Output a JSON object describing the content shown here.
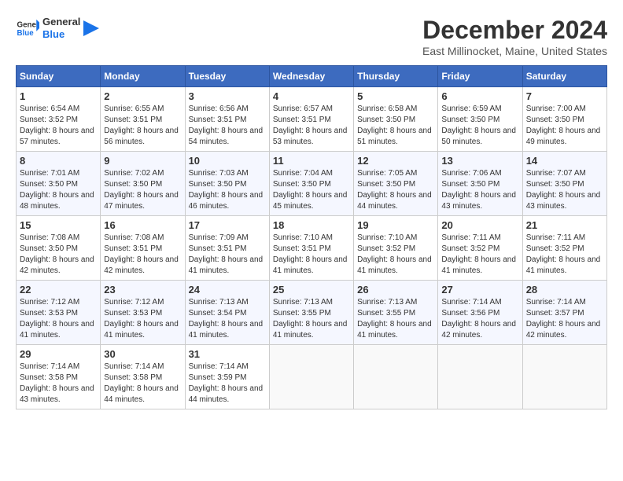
{
  "logo": {
    "text_general": "General",
    "text_blue": "Blue"
  },
  "title": "December 2024",
  "subtitle": "East Millinocket, Maine, United States",
  "weekdays": [
    "Sunday",
    "Monday",
    "Tuesday",
    "Wednesday",
    "Thursday",
    "Friday",
    "Saturday"
  ],
  "weeks": [
    [
      {
        "day": "1",
        "sunrise": "6:54 AM",
        "sunset": "3:52 PM",
        "daylight": "8 hours and 57 minutes."
      },
      {
        "day": "2",
        "sunrise": "6:55 AM",
        "sunset": "3:51 PM",
        "daylight": "8 hours and 56 minutes."
      },
      {
        "day": "3",
        "sunrise": "6:56 AM",
        "sunset": "3:51 PM",
        "daylight": "8 hours and 54 minutes."
      },
      {
        "day": "4",
        "sunrise": "6:57 AM",
        "sunset": "3:51 PM",
        "daylight": "8 hours and 53 minutes."
      },
      {
        "day": "5",
        "sunrise": "6:58 AM",
        "sunset": "3:50 PM",
        "daylight": "8 hours and 51 minutes."
      },
      {
        "day": "6",
        "sunrise": "6:59 AM",
        "sunset": "3:50 PM",
        "daylight": "8 hours and 50 minutes."
      },
      {
        "day": "7",
        "sunrise": "7:00 AM",
        "sunset": "3:50 PM",
        "daylight": "8 hours and 49 minutes."
      }
    ],
    [
      {
        "day": "8",
        "sunrise": "7:01 AM",
        "sunset": "3:50 PM",
        "daylight": "8 hours and 48 minutes."
      },
      {
        "day": "9",
        "sunrise": "7:02 AM",
        "sunset": "3:50 PM",
        "daylight": "8 hours and 47 minutes."
      },
      {
        "day": "10",
        "sunrise": "7:03 AM",
        "sunset": "3:50 PM",
        "daylight": "8 hours and 46 minutes."
      },
      {
        "day": "11",
        "sunrise": "7:04 AM",
        "sunset": "3:50 PM",
        "daylight": "8 hours and 45 minutes."
      },
      {
        "day": "12",
        "sunrise": "7:05 AM",
        "sunset": "3:50 PM",
        "daylight": "8 hours and 44 minutes."
      },
      {
        "day": "13",
        "sunrise": "7:06 AM",
        "sunset": "3:50 PM",
        "daylight": "8 hours and 43 minutes."
      },
      {
        "day": "14",
        "sunrise": "7:07 AM",
        "sunset": "3:50 PM",
        "daylight": "8 hours and 43 minutes."
      }
    ],
    [
      {
        "day": "15",
        "sunrise": "7:08 AM",
        "sunset": "3:50 PM",
        "daylight": "8 hours and 42 minutes."
      },
      {
        "day": "16",
        "sunrise": "7:08 AM",
        "sunset": "3:51 PM",
        "daylight": "8 hours and 42 minutes."
      },
      {
        "day": "17",
        "sunrise": "7:09 AM",
        "sunset": "3:51 PM",
        "daylight": "8 hours and 41 minutes."
      },
      {
        "day": "18",
        "sunrise": "7:10 AM",
        "sunset": "3:51 PM",
        "daylight": "8 hours and 41 minutes."
      },
      {
        "day": "19",
        "sunrise": "7:10 AM",
        "sunset": "3:52 PM",
        "daylight": "8 hours and 41 minutes."
      },
      {
        "day": "20",
        "sunrise": "7:11 AM",
        "sunset": "3:52 PM",
        "daylight": "8 hours and 41 minutes."
      },
      {
        "day": "21",
        "sunrise": "7:11 AM",
        "sunset": "3:52 PM",
        "daylight": "8 hours and 41 minutes."
      }
    ],
    [
      {
        "day": "22",
        "sunrise": "7:12 AM",
        "sunset": "3:53 PM",
        "daylight": "8 hours and 41 minutes."
      },
      {
        "day": "23",
        "sunrise": "7:12 AM",
        "sunset": "3:53 PM",
        "daylight": "8 hours and 41 minutes."
      },
      {
        "day": "24",
        "sunrise": "7:13 AM",
        "sunset": "3:54 PM",
        "daylight": "8 hours and 41 minutes."
      },
      {
        "day": "25",
        "sunrise": "7:13 AM",
        "sunset": "3:55 PM",
        "daylight": "8 hours and 41 minutes."
      },
      {
        "day": "26",
        "sunrise": "7:13 AM",
        "sunset": "3:55 PM",
        "daylight": "8 hours and 41 minutes."
      },
      {
        "day": "27",
        "sunrise": "7:14 AM",
        "sunset": "3:56 PM",
        "daylight": "8 hours and 42 minutes."
      },
      {
        "day": "28",
        "sunrise": "7:14 AM",
        "sunset": "3:57 PM",
        "daylight": "8 hours and 42 minutes."
      }
    ],
    [
      {
        "day": "29",
        "sunrise": "7:14 AM",
        "sunset": "3:58 PM",
        "daylight": "8 hours and 43 minutes."
      },
      {
        "day": "30",
        "sunrise": "7:14 AM",
        "sunset": "3:58 PM",
        "daylight": "8 hours and 44 minutes."
      },
      {
        "day": "31",
        "sunrise": "7:14 AM",
        "sunset": "3:59 PM",
        "daylight": "8 hours and 44 minutes."
      },
      null,
      null,
      null,
      null
    ]
  ],
  "labels": {
    "sunrise": "Sunrise:",
    "sunset": "Sunset:",
    "daylight": "Daylight:"
  }
}
